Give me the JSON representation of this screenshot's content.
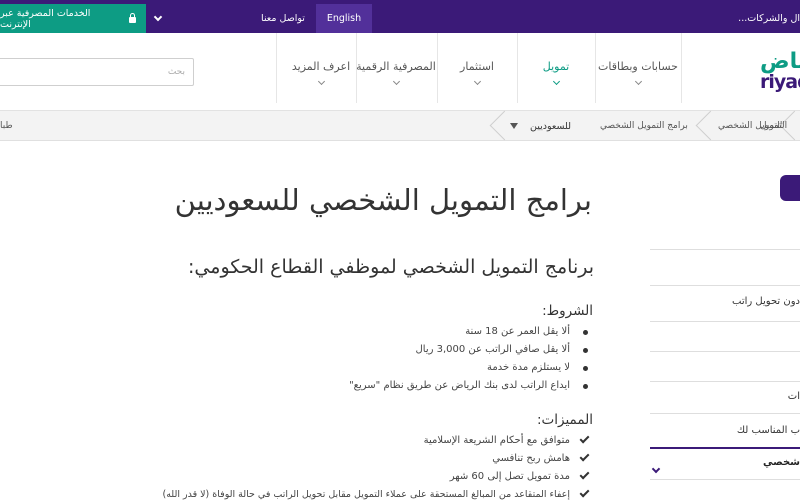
{
  "topbar": {
    "online_banking": "الخدمات المصرفية عبر الإنترنت",
    "contact": "تواصل معنا",
    "language": "English",
    "corporate": "...ال والشركات"
  },
  "header": {
    "search_placeholder": "بحث",
    "logo_ar": "ياض",
    "logo_en": "riyad",
    "nav": [
      {
        "label": "حسابات وبطاقات"
      },
      {
        "label": "تمويل",
        "active": true
      },
      {
        "label": "استثمار"
      },
      {
        "label": "المصرفية الرقمية"
      },
      {
        "label": "اعرف المزيد"
      }
    ]
  },
  "breadcrumb": {
    "items": [
      "التمويل",
      "التمويل الشخصي",
      "برامج التمويل الشخصي",
      "للسعوديين"
    ],
    "left_cutoff": "طبا"
  },
  "main": {
    "title": "برامج التمويل الشخصي للسعوديين",
    "subtitle": "برنامج التمويل الشخصي لموظفي القطاع الحكومي:",
    "conditions_heading": "الشروط:",
    "conditions": [
      "ألا يقل العمر عن 18 سنة",
      "ألا يقل صافي الراتب عن 3,000 ريال",
      "لا يستلزم مدة خدمة",
      "ايداع الراتب لدى بنك الرياض عن طريق نظام \"سريع\""
    ],
    "features_heading": "المميزات:",
    "features": [
      "متوافق مع أحكام الشريعة الإسلامية",
      "هامش ربح تنافسي",
      "مدة تمويل تصل إلى 60 شهر",
      "إعفاء المتقاعد من المبالغ المستحقة على عملاء التمويل مقابل تحويل الراتب في حالة الوفاة (لا قدر الله)"
    ]
  },
  "sidebar": {
    "items": [
      "دون تحويل راتب",
      "ات",
      "ب المناسب لك",
      "شخصي"
    ]
  },
  "colors": {
    "brand_purple": "#3b1a78",
    "brand_green": "#0d9c84"
  }
}
